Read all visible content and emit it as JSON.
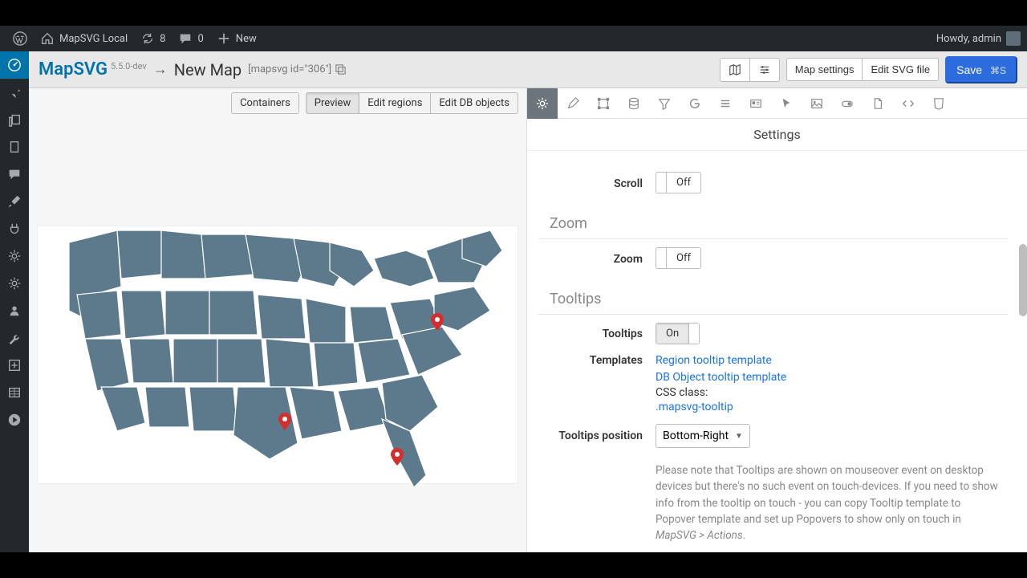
{
  "wpbar": {
    "site": "MapSVG Local",
    "updates": "8",
    "comments": "0",
    "new": "New",
    "howdy": "Howdy, admin"
  },
  "header": {
    "brand": "MapSVG",
    "version": "5.5.0-dev",
    "arrow": "→",
    "map_name": "New Map",
    "shortcode": "[mapsvg id=\"306\"]",
    "btn_map_settings": "Map settings",
    "btn_edit_svg": "Edit SVG file",
    "btn_save": "Save",
    "save_kbd": "⌘S"
  },
  "left_tabs": {
    "containers": "Containers",
    "preview": "Preview",
    "edit_regions": "Edit regions",
    "edit_db": "Edit DB objects"
  },
  "right_panel": {
    "title": "Settings",
    "scroll_label": "Scroll",
    "scroll_value": "Off",
    "zoom_section": "Zoom",
    "zoom_label": "Zoom",
    "zoom_value": "Off",
    "tooltips_section": "Tooltips",
    "tooltips_label": "Tooltips",
    "tooltips_value": "On",
    "templates_label": "Templates",
    "templates": {
      "region": "Region tooltip template",
      "db": "DB Object tooltip template",
      "css_prefix": "CSS class: ",
      "css_class": ".mapsvg-tooltip"
    },
    "position_label": "Tooltips position",
    "position_value": "Bottom-Right",
    "note": "Please note that Tooltips are shown on mouseover event on desktop devices but there's no such event on touch-devices. If you need to show info from the tooltip on touch - you can copy Tooltip template to Popover template and set up Popovers to show only on touch in ",
    "note_em": "MapSVG > Actions",
    "note_end": "."
  }
}
